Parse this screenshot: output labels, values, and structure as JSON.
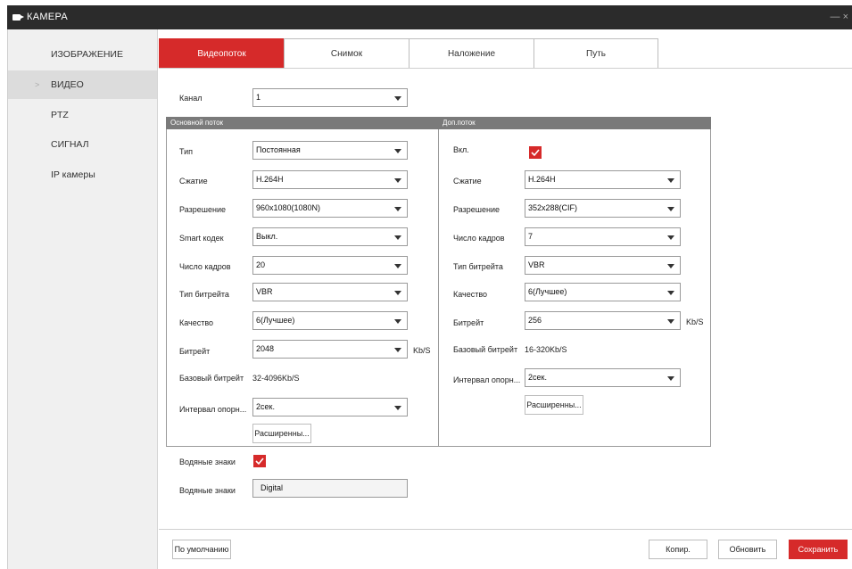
{
  "window": {
    "title": "КАМЕРА",
    "controls": "— ×"
  },
  "sidebar": {
    "items": [
      {
        "label": "ИЗОБРАЖЕНИЕ",
        "active": false
      },
      {
        "label": "ВИДЕО",
        "active": true
      },
      {
        "label": "PTZ",
        "active": false
      },
      {
        "label": "СИГНАЛ",
        "active": false
      },
      {
        "label": "IP камеры",
        "active": false
      }
    ]
  },
  "tabs": [
    {
      "label": "Видеопоток",
      "active": true
    },
    {
      "label": "Снимок",
      "active": false
    },
    {
      "label": "Наложение",
      "active": false
    },
    {
      "label": "Путь",
      "active": false
    }
  ],
  "channel": {
    "label": "Канал",
    "value": "1"
  },
  "main_stream": {
    "header": "Основной поток",
    "type": {
      "label": "Тип",
      "value": "Постоянная"
    },
    "compression": {
      "label": "Сжатие",
      "value": "H.264H"
    },
    "resolution": {
      "label": "Разрешение",
      "value": "960x1080(1080N)"
    },
    "smart_codec": {
      "label": "Smart кодек",
      "value": "Выкл."
    },
    "frame_rate": {
      "label": "Число кадров",
      "value": "20"
    },
    "bitrate_type": {
      "label": "Тип битрейта",
      "value": "VBR"
    },
    "quality": {
      "label": "Качество",
      "value": "6(Лучшее)"
    },
    "bitrate": {
      "label": "Битрейт",
      "value": "2048",
      "unit": "Kb/S"
    },
    "base_bitrate": {
      "label": "Базовый битрейт",
      "value": "32-4096Kb/S"
    },
    "iframe_interval": {
      "label": "Интервал опорн...",
      "value": "2сек."
    },
    "advanced_button": "Расширенны..."
  },
  "sub_stream": {
    "header": "Доп.поток",
    "enable": {
      "label": "Вкл.",
      "checked": true
    },
    "compression": {
      "label": "Сжатие",
      "value": "H.264H"
    },
    "resolution": {
      "label": "Разрешение",
      "value": "352x288(CIF)"
    },
    "frame_rate": {
      "label": "Число кадров",
      "value": "7"
    },
    "bitrate_type": {
      "label": "Тип битрейта",
      "value": "VBR"
    },
    "quality": {
      "label": "Качество",
      "value": "6(Лучшее)"
    },
    "bitrate": {
      "label": "Битрейт",
      "value": "256",
      "unit": "Kb/S"
    },
    "base_bitrate": {
      "label": "Базовый битрейт",
      "value": "16-320Kb/S"
    },
    "iframe_interval": {
      "label": "Интервал опорн...",
      "value": "2сек."
    },
    "advanced_button": "Расширенны..."
  },
  "watermark": {
    "enable": {
      "label": "Водяные знаки",
      "checked": true
    },
    "text": {
      "label": "Водяные знаки",
      "value": "Digital"
    }
  },
  "footer": {
    "default_button": "По умолчанию",
    "copy_button": "Копир.",
    "refresh_button": "Обновить",
    "save_button": "Сохранить"
  },
  "colors": {
    "accent": "#d62a2a",
    "titlebar": "#2b2b2b",
    "panel_header": "#7a7a7a"
  }
}
